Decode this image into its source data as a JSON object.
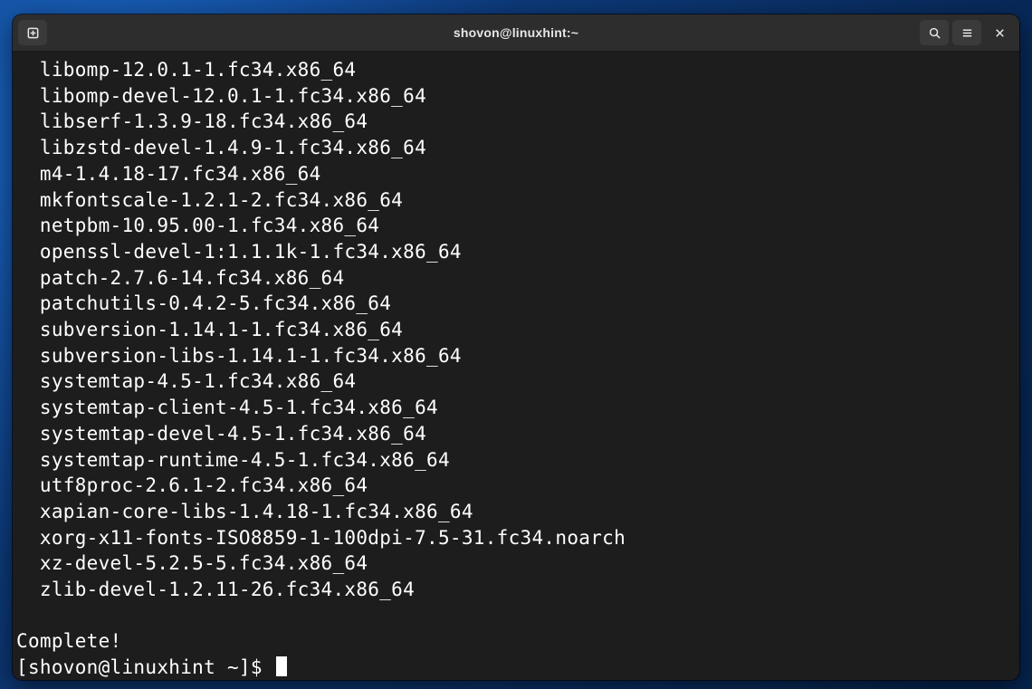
{
  "window": {
    "title": "shovon@linuxhint:~"
  },
  "terminal": {
    "packages": [
      "libomp-12.0.1-1.fc34.x86_64",
      "libomp-devel-12.0.1-1.fc34.x86_64",
      "libserf-1.3.9-18.fc34.x86_64",
      "libzstd-devel-1.4.9-1.fc34.x86_64",
      "m4-1.4.18-17.fc34.x86_64",
      "mkfontscale-1.2.1-2.fc34.x86_64",
      "netpbm-10.95.00-1.fc34.x86_64",
      "openssl-devel-1:1.1.1k-1.fc34.x86_64",
      "patch-2.7.6-14.fc34.x86_64",
      "patchutils-0.4.2-5.fc34.x86_64",
      "subversion-1.14.1-1.fc34.x86_64",
      "subversion-libs-1.14.1-1.fc34.x86_64",
      "systemtap-4.5-1.fc34.x86_64",
      "systemtap-client-4.5-1.fc34.x86_64",
      "systemtap-devel-4.5-1.fc34.x86_64",
      "systemtap-runtime-4.5-1.fc34.x86_64",
      "utf8proc-2.6.1-2.fc34.x86_64",
      "xapian-core-libs-1.4.18-1.fc34.x86_64",
      "xorg-x11-fonts-ISO8859-1-100dpi-7.5-31.fc34.noarch",
      "xz-devel-5.2.5-5.fc34.x86_64",
      "zlib-devel-1.2.11-26.fc34.x86_64"
    ],
    "status": "Complete!",
    "prompt": "[shovon@linuxhint ~]$"
  }
}
